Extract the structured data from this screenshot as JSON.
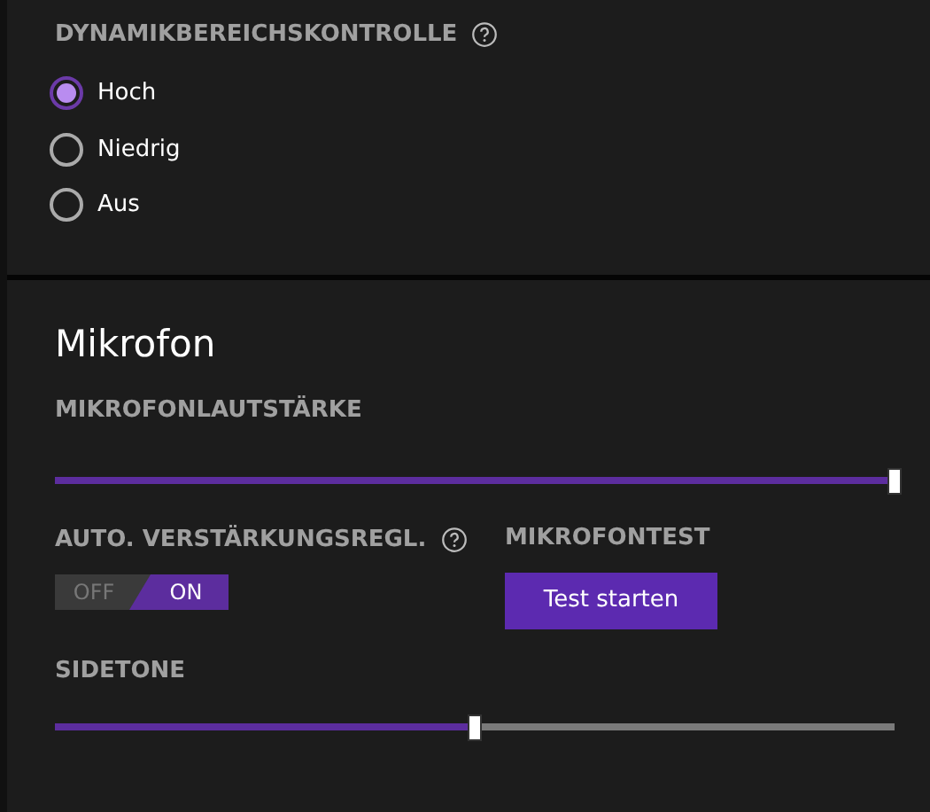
{
  "dynamic_range": {
    "heading": "DYNAMIKBEREICHSKONTROLLE",
    "options": [
      {
        "label": "Hoch",
        "selected": true
      },
      {
        "label": "Niedrig",
        "selected": false
      },
      {
        "label": "Aus",
        "selected": false
      }
    ]
  },
  "microphone": {
    "title": "Mikrofon",
    "volume": {
      "label": "MIKROFONLAUTSTÄRKE",
      "level": 1.0
    },
    "agc": {
      "label": "AUTO. VERSTÄRKUNGSREGL.",
      "off_label": "OFF",
      "on_label": "ON",
      "on": true
    },
    "test": {
      "label": "MIKROFONTEST",
      "button": "Test starten"
    },
    "sidetone": {
      "label": "SIDETONE",
      "level": 0.5
    }
  }
}
